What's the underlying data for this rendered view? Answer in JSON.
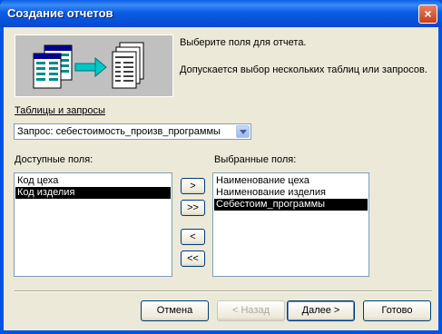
{
  "window": {
    "title": "Создание отчетов",
    "close_label": "×"
  },
  "info": {
    "line1": "Выберите поля для отчета.",
    "line2": "Допускается выбор нескольких таблиц или запросов."
  },
  "tables": {
    "label": "Таблицы и запросы",
    "selected": "Запрос: себестоимость_произв_программы"
  },
  "available": {
    "label": "Доступные поля:",
    "items": [
      "Код цеха",
      "Код изделия"
    ],
    "selected_index": 1
  },
  "chosen": {
    "label": "Выбранные поля:",
    "items": [
      "Наименование цеха",
      "Наименование изделия",
      "Себестоим_программы"
    ],
    "selected_index": 2
  },
  "move_buttons": {
    "add": ">",
    "add_all": ">>",
    "remove": "<",
    "remove_all": "<<"
  },
  "footer": {
    "cancel": "Отмена",
    "back": "< Назад",
    "next": "Далее >",
    "finish": "Готово"
  },
  "colors": {
    "titlebar": "#0054e3",
    "dialog": "#ece9d8",
    "selection": "#000000"
  }
}
